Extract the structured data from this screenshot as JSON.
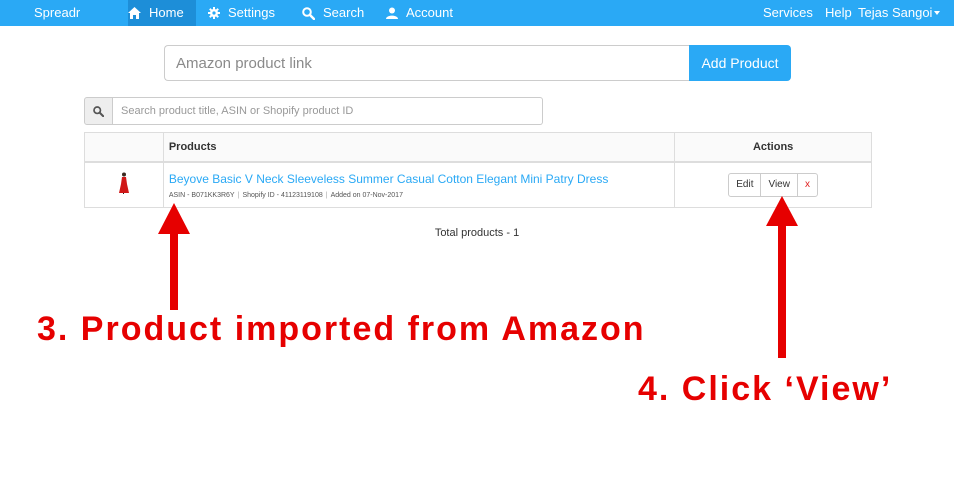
{
  "nav": {
    "brand": "Spreadr",
    "items": [
      {
        "label": "Home",
        "icon": "home-icon"
      },
      {
        "label": "Settings",
        "icon": "gear-icon"
      },
      {
        "label": "Search",
        "icon": "search-icon"
      },
      {
        "label": "Account",
        "icon": "user-icon"
      }
    ],
    "right": {
      "services": "Services",
      "help": "Help",
      "user": "Tejas Sangoi"
    }
  },
  "add_product": {
    "placeholder": "Amazon product link",
    "button": "Add Product"
  },
  "search": {
    "placeholder": "Search product title, ASIN or Shopify product ID",
    "icon": "search-icon"
  },
  "table": {
    "headers": {
      "products": "Products",
      "actions": "Actions"
    },
    "rows": [
      {
        "title": "Beyove Basic V Neck Sleeveless Summer Casual Cotton Elegant Mini Patry Dress",
        "asin": "ASIN - B071KK3R6Y",
        "shopify_id": "Shopify ID - 41123119108",
        "added": "Added on 07-Nov-2017",
        "actions": {
          "edit": "Edit",
          "view": "View",
          "delete": "x"
        }
      }
    ]
  },
  "total": "Total products - 1",
  "annotations": {
    "step3": "3. Product imported from Amazon",
    "step4": "4. Click ‘View’"
  },
  "colors": {
    "accent": "#2aa9f5",
    "annotation_red": "#e60000",
    "delete_red": "#e02020"
  }
}
